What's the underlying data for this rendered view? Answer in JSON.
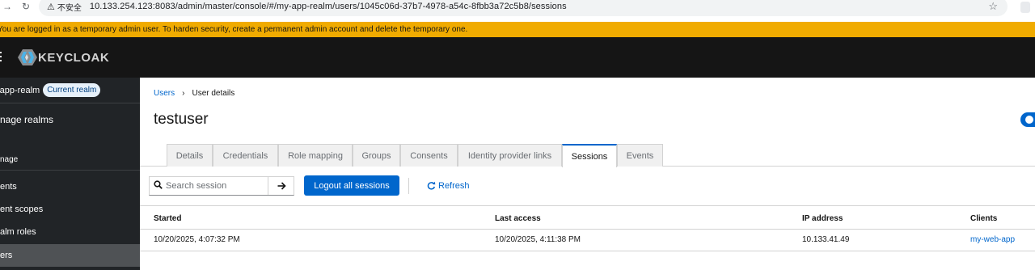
{
  "browser": {
    "security_warning": "不安全",
    "url": "10.133.254.123:8083/admin/master/console/#/my-app-realm/users/1045c06d-37b7-4978-a54c-8fbb3a72c5b8/sessions"
  },
  "banner": {
    "text": "You are logged in as a temporary admin user. To harden security, create a permanent admin account and delete the temporary one."
  },
  "header": {
    "logo_text": "KEYCLOAK"
  },
  "sidebar": {
    "realm_name": "-app-realm",
    "realm_badge": "Current realm",
    "items": [
      {
        "label": "nage realms"
      },
      {
        "label": "nage"
      },
      {
        "label": "ents"
      },
      {
        "label": "ent scopes"
      },
      {
        "label": "alm roles"
      },
      {
        "label": "ers"
      }
    ]
  },
  "breadcrumb": {
    "root": "Users",
    "current": "User details"
  },
  "page": {
    "title": "testuser"
  },
  "tabs": [
    {
      "label": "Details"
    },
    {
      "label": "Credentials"
    },
    {
      "label": "Role mapping"
    },
    {
      "label": "Groups"
    },
    {
      "label": "Consents"
    },
    {
      "label": "Identity provider links"
    },
    {
      "label": "Sessions"
    },
    {
      "label": "Events"
    }
  ],
  "active_tab": "Sessions",
  "toolbar": {
    "search_placeholder": "Search session",
    "logout_label": "Logout all sessions",
    "refresh_label": "Refresh"
  },
  "table": {
    "headers": [
      "Started",
      "Last access",
      "IP address",
      "Clients"
    ],
    "rows": [
      {
        "started": "10/20/2025, 4:07:32 PM",
        "last_access": "10/20/2025, 4:11:38 PM",
        "ip": "10.133.41.49",
        "client": "my-web-app"
      }
    ]
  },
  "colors": {
    "banner": "#f0ab00",
    "masthead": "#151515",
    "sidebar": "#212427",
    "accent": "#0066cc"
  }
}
